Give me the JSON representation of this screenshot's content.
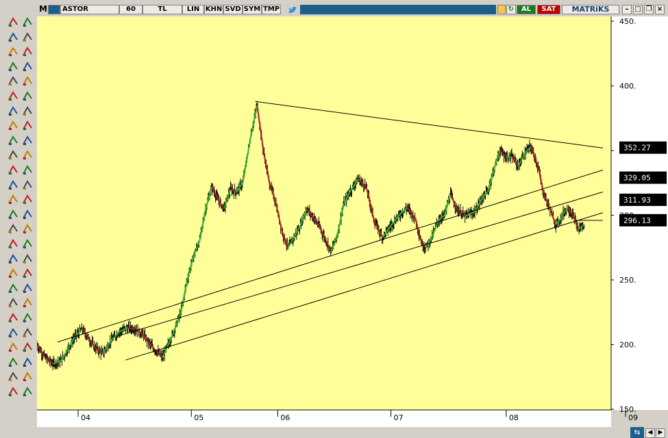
{
  "topbar": {
    "mode": "M",
    "symbol": "ASTOR",
    "period": "60",
    "currency": "TL",
    "buttons": [
      "LIN",
      "KHN",
      "SVD",
      "SYM",
      "TMP"
    ],
    "buy_label": "AL",
    "sell_label": "SAT",
    "brand": "MATRiKS",
    "refresh_icon": "refresh-icon",
    "twitter_icon": "twitter-icon",
    "colors": {
      "buy": "#1f7a1f",
      "sell": "#c00000",
      "bar": "#1b5f8a"
    }
  },
  "toolbar": {
    "icons": [
      "trend-line-icon",
      "lock-icon",
      "fan-icon",
      "cursor-arrow-icon",
      "parallel-channel-icon",
      "crosshair-icon",
      "grid-lines-icon",
      "pencil-icon",
      "horizontal-lines-icon",
      "tools-icon",
      "diagonal-lines-icon",
      "ruler-icon",
      "gann-icon",
      "ruler-2-icon",
      "cycles-icon",
      "align-left-icon",
      "label-icon",
      "align-right-icon",
      "pattern-icon",
      "minus-icon",
      "bell-icon",
      "signal-icon",
      "expand-h-icon",
      "vertical-line-icon",
      "move-icon",
      "magnet-icon",
      "zoom-fit-icon",
      "eraser-icon",
      "move-v-icon",
      "diagonal-ruler-icon",
      "asterisk-icon",
      "ruler-3-icon",
      "arrow-left-icon",
      "bookmark-icon",
      "arrow-right-icon",
      "indicator-icon",
      "arrow-up-icon",
      "indicator-2-icon",
      "arrow-down-icon",
      "indicator-3-icon",
      "zoom-in-icon",
      "indicator-4-icon",
      "zoom-out-icon",
      "scissors-icon",
      "fibonacci-icon",
      "indicator-5-icon",
      "arch-icon",
      "indicator-6-icon",
      "arc-icon",
      "indicator-7-icon",
      "indicator-8-icon",
      "indicator-9-icon"
    ]
  },
  "chart_data": {
    "type": "line",
    "style": "ohlc-bars",
    "symbol": "ASTOR",
    "y_ticks": [
      "450.",
      "400.",
      "350.",
      "300.",
      "250.",
      "200.",
      "150."
    ],
    "ylim": [
      150,
      450
    ],
    "x_ticks": [
      "04",
      "05",
      "06",
      "07",
      "08",
      "09"
    ],
    "grid": false,
    "colors": {
      "background": "#ffff99",
      "up": "#2db82d",
      "down": "#b32020",
      "bar": "#111111"
    },
    "series": [
      {
        "values": [
          [
            0,
            200
          ],
          [
            4,
            190
          ],
          [
            8,
            185
          ],
          [
            12,
            188
          ],
          [
            18,
            205
          ],
          [
            22,
            212
          ],
          [
            28,
            198
          ],
          [
            32,
            193
          ],
          [
            36,
            203
          ],
          [
            40,
            210
          ],
          [
            44,
            213
          ],
          [
            48,
            212
          ],
          [
            52,
            207
          ],
          [
            55,
            200
          ],
          [
            58,
            195
          ],
          [
            61,
            190
          ],
          [
            66,
            208
          ],
          [
            70,
            225
          ],
          [
            73,
            250
          ],
          [
            76,
            268
          ],
          [
            79,
            280
          ],
          [
            82,
            305
          ],
          [
            85,
            322
          ],
          [
            88,
            312
          ],
          [
            91,
            305
          ],
          [
            94,
            320
          ],
          [
            97,
            318
          ],
          [
            100,
            325
          ],
          [
            104,
            362
          ],
          [
            107,
            385
          ],
          [
            110,
            350
          ],
          [
            113,
            325
          ],
          [
            116,
            310
          ],
          [
            119,
            288
          ],
          [
            122,
            275
          ],
          [
            125,
            283
          ],
          [
            128,
            292
          ],
          [
            131,
            305
          ],
          [
            134,
            299
          ],
          [
            137,
            292
          ],
          [
            140,
            282
          ],
          [
            143,
            272
          ],
          [
            146,
            285
          ],
          [
            149,
            308
          ],
          [
            152,
            318
          ],
          [
            156,
            328
          ],
          [
            160,
            322
          ],
          [
            164,
            295
          ],
          [
            168,
            283
          ],
          [
            172,
            292
          ],
          [
            176,
            300
          ],
          [
            180,
            306
          ],
          [
            184,
            297
          ],
          [
            187,
            278
          ],
          [
            189,
            275
          ],
          [
            192,
            283
          ],
          [
            195,
            296
          ],
          [
            198,
            300
          ],
          [
            201,
            316
          ],
          [
            204,
            305
          ],
          [
            208,
            299
          ],
          [
            213,
            303
          ],
          [
            217,
            315
          ],
          [
            219,
            318
          ],
          [
            222,
            335
          ],
          [
            225,
            350
          ],
          [
            228,
            345
          ],
          [
            231,
            345
          ],
          [
            234,
            338
          ],
          [
            237,
            348
          ],
          [
            240,
            353
          ],
          [
            242,
            345
          ],
          [
            244,
            334
          ],
          [
            246,
            318
          ],
          [
            249,
            306
          ],
          [
            252,
            293
          ],
          [
            254,
            296
          ],
          [
            256,
            302
          ],
          [
            258,
            306
          ],
          [
            261,
            298
          ],
          [
            263,
            289
          ],
          [
            266,
            293
          ]
        ]
      }
    ],
    "trendlines": [
      {
        "from": [
          106,
          388
        ],
        "to": [
          275,
          352
        ]
      },
      {
        "from": [
          10,
          202
        ],
        "to": [
          275,
          335
        ]
      },
      {
        "from": [
          40,
          207
        ],
        "to": [
          275,
          318
        ]
      },
      {
        "from": [
          43,
          188
        ],
        "to": [
          275,
          302
        ]
      },
      {
        "from": [
          262,
          296
        ],
        "to": [
          275,
          296
        ]
      }
    ],
    "price_labels": [
      "352.27",
      "329.05",
      "311.93",
      "296.13"
    ],
    "price_label_values": [
      352.27,
      329.05,
      311.93,
      296.13
    ]
  }
}
